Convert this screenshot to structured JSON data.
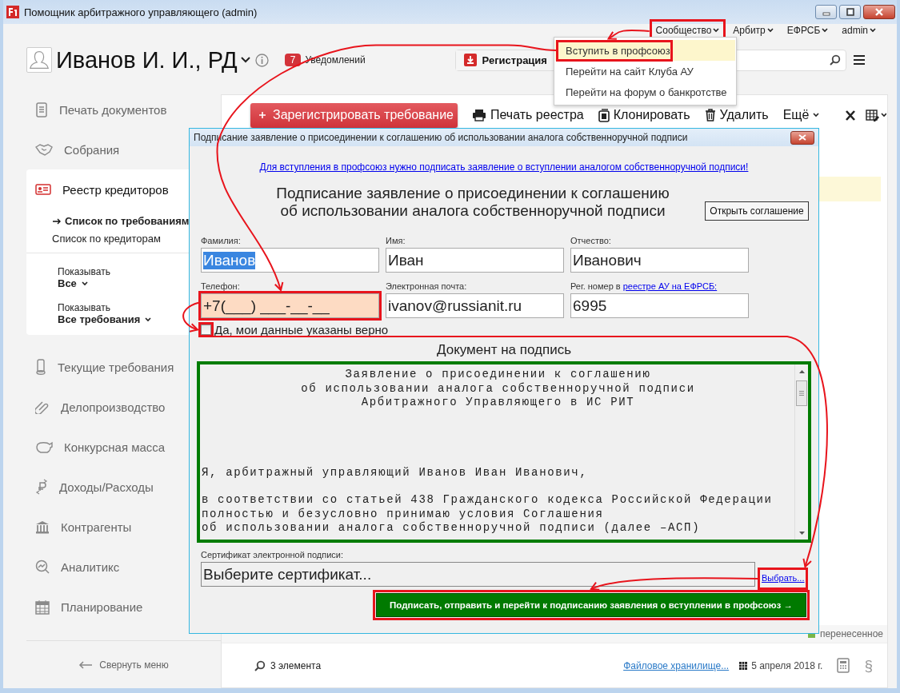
{
  "window": {
    "title": "Помощник арбитражного управляющего (admin)"
  },
  "top_nav": [
    {
      "label": "Сообщество",
      "annotated": true
    },
    {
      "label": "Арбитр",
      "annotated": false
    },
    {
      "label": "ЕФРСБ",
      "annotated": false
    },
    {
      "label": "admin",
      "annotated": false
    }
  ],
  "community_menu": [
    {
      "label": "Вступить в профсоюз",
      "selected": true,
      "annotated": true
    },
    {
      "label": "Перейти на сайт Клуба АУ",
      "selected": false,
      "annotated": false
    },
    {
      "label": "Перейти на форум о банкротстве",
      "selected": false,
      "annotated": false
    }
  ],
  "header": {
    "user": "Иванов И. И., РД",
    "notifications_count": "7",
    "notifications_label": "Уведомлений",
    "register_button": "Регистрация"
  },
  "sidebar": {
    "items": [
      {
        "label": "Печать документов",
        "selected": false
      },
      {
        "label": "Собрания",
        "selected": false
      },
      {
        "label": "Реестр кредиторов",
        "selected": true,
        "children": [
          {
            "label": "Список по требованиям",
            "selected": true
          },
          {
            "label": "Список по кредиторам",
            "selected": false
          }
        ],
        "filters": [
          {
            "label": "Показывать",
            "value": "Все"
          },
          {
            "label": "Показывать",
            "value": "Все требования"
          }
        ]
      },
      {
        "label": "Текущие требования",
        "selected": false
      },
      {
        "label": "Делопроизводство",
        "selected": false
      },
      {
        "label": "Конкурсная масса",
        "selected": false
      },
      {
        "label": "Доходы/Расходы",
        "selected": false
      },
      {
        "label": "Контрагенты",
        "selected": false
      },
      {
        "label": "Аналитикс",
        "selected": false
      },
      {
        "label": "Планирование",
        "selected": false
      }
    ],
    "collapse": "Свернуть меню"
  },
  "toolbar": {
    "primary": "Зарегистрировать требование",
    "actions": [
      {
        "label": "Печать реестра"
      },
      {
        "label": "Клонировать"
      },
      {
        "label": "Удалить"
      },
      {
        "label": "Ещё"
      }
    ]
  },
  "summary": {
    "legend_label": "перенесенное"
  },
  "footer": {
    "count": "3 элемента",
    "storage_link": "Файловое хранилище...",
    "date": "5 апреля 2018 г.",
    "section_sign": "§"
  },
  "dialog": {
    "title": "Подписание заявление о присоединении к соглашению об использовании аналога собственноручной подписи",
    "notice_link": "Для вступления в профсоюз нужно подписать заявление о вступлении аналогом собственноручной подписи!",
    "heading_lines": [
      "Подписание заявление о присоединении к соглашению",
      "об использовании аналога собственноручной подписи"
    ],
    "open_agreement": "Открыть соглашение",
    "fields": [
      {
        "label": "Фамилия:",
        "value": "Иванов",
        "selected": true,
        "invalid": false,
        "annotated": false
      },
      {
        "label": "Имя:",
        "value": "Иван",
        "selected": false,
        "invalid": false,
        "annotated": false
      },
      {
        "label": "Отчество:",
        "value": "Иванович",
        "selected": false,
        "invalid": false,
        "annotated": false
      },
      {
        "label": "Телефон:",
        "value": "+7(___) ___-__-__",
        "selected": false,
        "invalid": true,
        "annotated": true
      },
      {
        "label": "Электронная почта:",
        "value": "ivanov@russianit.ru",
        "selected": false,
        "invalid": false,
        "annotated": false
      },
      {
        "label": "Рег. номер в",
        "link": "реестре АУ на ЕФРСБ:",
        "value": "6995",
        "selected": false,
        "invalid": false,
        "annotated": false
      }
    ],
    "confirm": {
      "label": "Да, мои данные указаны верно",
      "checked": false,
      "annotated": true
    },
    "document_title": "Документ на подпись",
    "document": [
      {
        "kind": "centered",
        "lines": [
          "Заявление о присоединении к соглашению",
          "об использовании аналога собственноручной подписи",
          "Арбитражного Управляющего в ИС РИТ"
        ]
      },
      {
        "kind": "body",
        "lines": [
          "Я, арбитражный управляющий Иванов Иван Иванович,"
        ]
      },
      {
        "kind": "body",
        "lines": [
          "в соответствии со статьей 438 Гражданского кодекса Российской Федерации",
          "полностью и безусловно принимаю условия Соглашения",
          "об использовании аналога собственноручной подписи (далее –АСП)"
        ]
      }
    ],
    "certificate": {
      "label": "Сертификат электронной подписи:",
      "placeholder": "Выберите сертификат...",
      "choose_link": "Выбрать...",
      "annotated": true
    },
    "sign_button": {
      "label": "Подписать, отправить и перейти к подписанию заявления о вступлении в профсоюз →",
      "annotated": true
    }
  }
}
